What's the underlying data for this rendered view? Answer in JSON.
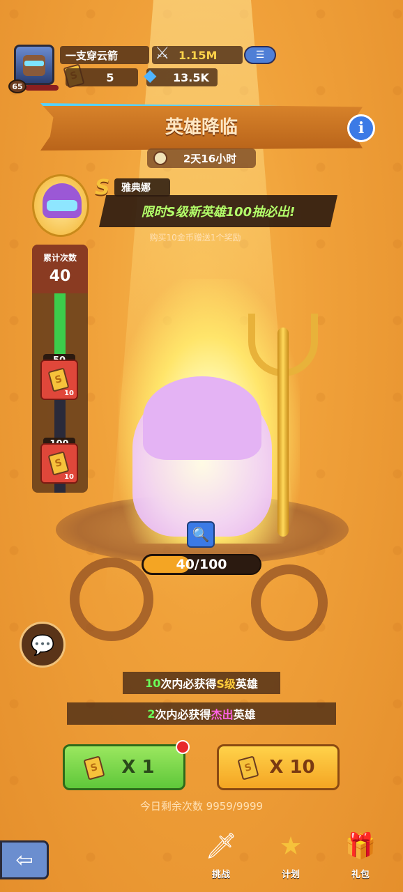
{
  "player": {
    "name": "一支穿云箭",
    "level": "65",
    "power": "1.15M",
    "tickets": "5",
    "gems": "13.5K"
  },
  "event": {
    "title": "英雄降临",
    "timer": "2天16小时",
    "hero_tier": "S",
    "hero_name": "雅典娜",
    "promo": "限时S级新英雄100抽必出!",
    "subpromo": "购买10金币赠送1个奖励"
  },
  "accumulate": {
    "label": "累计次数",
    "value": "40",
    "progress_fraction": 0.4,
    "milestones": [
      {
        "threshold": "50",
        "reward_count": "10"
      },
      {
        "threshold": "100",
        "reward_count": "10"
      }
    ]
  },
  "progress": {
    "text": "40/100",
    "fraction": 0.4
  },
  "guarantees": [
    {
      "num": "10",
      "mid": "次内必获得",
      "tier": "S级",
      "tail": "英雄"
    },
    {
      "num": "2",
      "mid": "次内必获得",
      "tier": "杰出",
      "tail": "英雄"
    }
  ],
  "draw": {
    "single_label": "X 1",
    "multi_label": "X 10",
    "remaining": "今日剩余次数 9959/9999"
  },
  "nav": [
    {
      "label": "挑战",
      "icon": "sword-stone-icon"
    },
    {
      "label": "计划",
      "icon": "s-star-icon"
    },
    {
      "label": "礼包",
      "icon": "gift-icon"
    }
  ],
  "colors": {
    "bg": "#f0a13a",
    "green_button": "#6fd146",
    "yellow_button": "#f7bd35",
    "accent_blue": "#3b7ae6",
    "epic_pink": "#ff62e4"
  }
}
